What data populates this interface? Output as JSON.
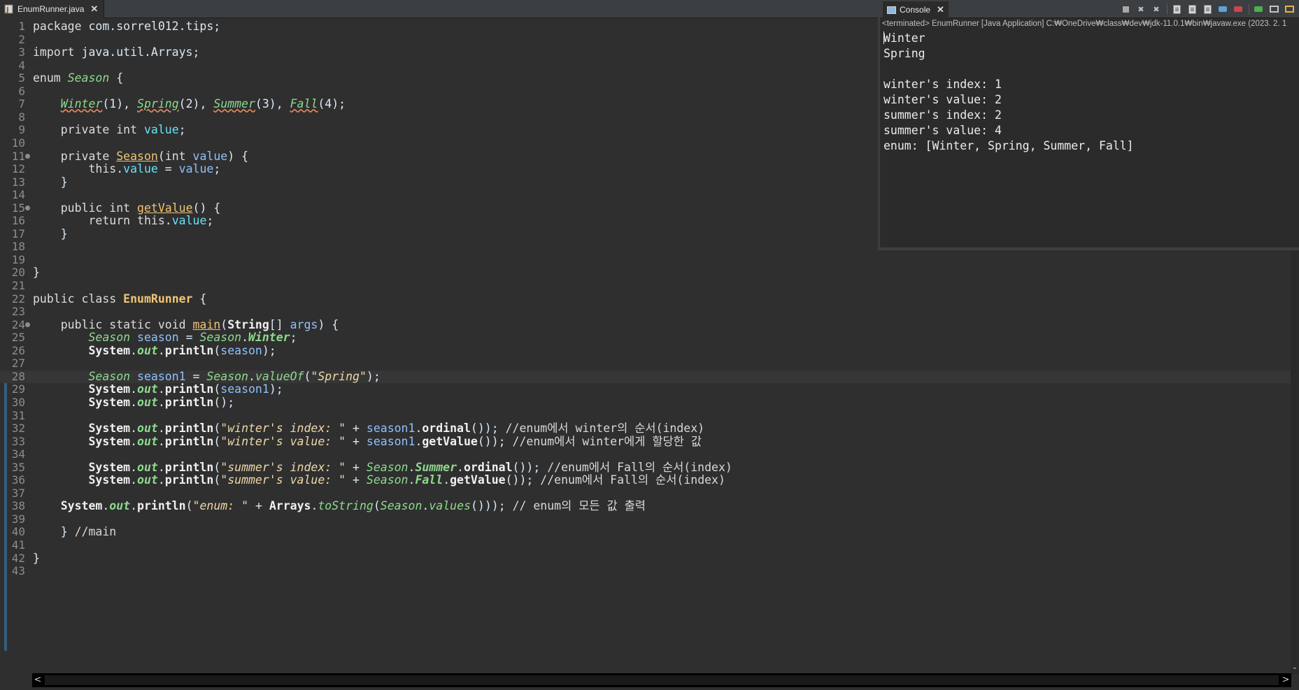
{
  "editor": {
    "tab": {
      "title": "EnumRunner.java",
      "close": "✕"
    },
    "current_line": 28,
    "lines": [
      {
        "n": "1",
        "segs": [
          [
            "kw",
            "package"
          ],
          [
            "t",
            " com.sorrel012.tips;"
          ]
        ]
      },
      {
        "n": "2",
        "segs": []
      },
      {
        "n": "3",
        "segs": [
          [
            "kw",
            "import"
          ],
          [
            "t",
            " java.util.Arrays;"
          ]
        ]
      },
      {
        "n": "4",
        "segs": []
      },
      {
        "n": "5",
        "segs": [
          [
            "kw",
            "enum"
          ],
          [
            "t",
            " "
          ],
          [
            "enm",
            "Season"
          ],
          [
            "t",
            " {"
          ]
        ]
      },
      {
        "n": "6",
        "segs": []
      },
      {
        "n": "7",
        "segs": [
          [
            "t",
            "    "
          ],
          [
            "cstw",
            "Winter"
          ],
          [
            "t",
            "(1), "
          ],
          [
            "cstw",
            "Spring"
          ],
          [
            "t",
            "(2), "
          ],
          [
            "cstw",
            "Summer"
          ],
          [
            "t",
            "(3), "
          ],
          [
            "cstw",
            "Fall"
          ],
          [
            "t",
            "(4);"
          ]
        ]
      },
      {
        "n": "8",
        "segs": []
      },
      {
        "n": "9",
        "segs": [
          [
            "t",
            "    "
          ],
          [
            "kw",
            "private int"
          ],
          [
            "t",
            " "
          ],
          [
            "fld",
            "value"
          ],
          [
            "t",
            ";"
          ]
        ]
      },
      {
        "n": "10",
        "segs": []
      },
      {
        "n": "11",
        "fold": true,
        "segs": [
          [
            "t",
            "    "
          ],
          [
            "kw",
            "private"
          ],
          [
            "t",
            " "
          ],
          [
            "decl",
            "Season"
          ],
          [
            "t",
            "("
          ],
          [
            "kw",
            "int"
          ],
          [
            "t",
            " "
          ],
          [
            "var",
            "value"
          ],
          [
            "t",
            ") {"
          ]
        ]
      },
      {
        "n": "12",
        "segs": [
          [
            "t",
            "        "
          ],
          [
            "kw",
            "this"
          ],
          [
            "t",
            "."
          ],
          [
            "fld",
            "value"
          ],
          [
            "t",
            " = "
          ],
          [
            "var",
            "value"
          ],
          [
            "t",
            ";"
          ]
        ]
      },
      {
        "n": "13",
        "segs": [
          [
            "t",
            "    }"
          ]
        ]
      },
      {
        "n": "14",
        "segs": []
      },
      {
        "n": "15",
        "fold": true,
        "segs": [
          [
            "t",
            "    "
          ],
          [
            "kw",
            "public int"
          ],
          [
            "t",
            " "
          ],
          [
            "decl",
            "getValue"
          ],
          [
            "t",
            "() {"
          ]
        ]
      },
      {
        "n": "16",
        "segs": [
          [
            "t",
            "        "
          ],
          [
            "kw",
            "return this"
          ],
          [
            "t",
            "."
          ],
          [
            "fld",
            "value"
          ],
          [
            "t",
            ";"
          ]
        ]
      },
      {
        "n": "17",
        "segs": [
          [
            "t",
            "    }"
          ]
        ]
      },
      {
        "n": "18",
        "segs": []
      },
      {
        "n": "19",
        "segs": []
      },
      {
        "n": "20",
        "segs": [
          [
            "t",
            "}"
          ]
        ]
      },
      {
        "n": "21",
        "segs": []
      },
      {
        "n": "22",
        "segs": [
          [
            "kw",
            "public class"
          ],
          [
            "t",
            " "
          ],
          [
            "cls",
            "EnumRunner"
          ],
          [
            "t",
            " {"
          ]
        ]
      },
      {
        "n": "23",
        "segs": []
      },
      {
        "n": "24",
        "fold": true,
        "segs": [
          [
            "t",
            "    "
          ],
          [
            "kw",
            "public static void"
          ],
          [
            "t",
            " "
          ],
          [
            "decl",
            "main"
          ],
          [
            "t",
            "("
          ],
          [
            "mth",
            "String"
          ],
          [
            "t",
            "[] "
          ],
          [
            "var",
            "args"
          ],
          [
            "t",
            ") {"
          ]
        ]
      },
      {
        "n": "25",
        "segs": [
          [
            "t",
            "        "
          ],
          [
            "enm",
            "Season"
          ],
          [
            "t",
            " "
          ],
          [
            "var",
            "season"
          ],
          [
            "t",
            " = "
          ],
          [
            "enm",
            "Season"
          ],
          [
            "t",
            "."
          ],
          [
            "sfld",
            "Winter"
          ],
          [
            "t",
            ";"
          ]
        ]
      },
      {
        "n": "26",
        "segs": [
          [
            "t",
            "        "
          ],
          [
            "mth",
            "System"
          ],
          [
            "t",
            "."
          ],
          [
            "sfld",
            "out"
          ],
          [
            "t",
            "."
          ],
          [
            "mth",
            "println"
          ],
          [
            "t",
            "("
          ],
          [
            "var",
            "season"
          ],
          [
            "t",
            ");"
          ]
        ]
      },
      {
        "n": "27",
        "segs": []
      },
      {
        "n": "28",
        "segs": [
          [
            "t",
            "        "
          ],
          [
            "enm",
            "Season"
          ],
          [
            "t",
            " "
          ],
          [
            "var",
            "season1"
          ],
          [
            "t",
            " = "
          ],
          [
            "enm",
            "Season"
          ],
          [
            "t",
            "."
          ],
          [
            "sst",
            "valueOf"
          ],
          [
            "t",
            "("
          ],
          [
            "str",
            "\"Spring\""
          ],
          [
            "t",
            ");"
          ]
        ]
      },
      {
        "n": "29",
        "segs": [
          [
            "t",
            "        "
          ],
          [
            "mth",
            "System"
          ],
          [
            "t",
            "."
          ],
          [
            "sfld",
            "out"
          ],
          [
            "t",
            "."
          ],
          [
            "mth",
            "println"
          ],
          [
            "t",
            "("
          ],
          [
            "var",
            "season1"
          ],
          [
            "t",
            ");"
          ]
        ]
      },
      {
        "n": "30",
        "segs": [
          [
            "t",
            "        "
          ],
          [
            "mth",
            "System"
          ],
          [
            "t",
            "."
          ],
          [
            "sfld",
            "out"
          ],
          [
            "t",
            "."
          ],
          [
            "mth",
            "println"
          ],
          [
            "t",
            "();"
          ]
        ]
      },
      {
        "n": "31",
        "segs": []
      },
      {
        "n": "32",
        "segs": [
          [
            "t",
            "        "
          ],
          [
            "mth",
            "System"
          ],
          [
            "t",
            "."
          ],
          [
            "sfld",
            "out"
          ],
          [
            "t",
            "."
          ],
          [
            "mth",
            "println"
          ],
          [
            "t",
            "("
          ],
          [
            "str",
            "\"winter's index: \""
          ],
          [
            "t",
            " + "
          ],
          [
            "var",
            "season1"
          ],
          [
            "t",
            "."
          ],
          [
            "mth",
            "ordinal"
          ],
          [
            "t",
            "()); "
          ],
          [
            "cmt",
            "//enum에서 winter의 순서(index)"
          ]
        ]
      },
      {
        "n": "33",
        "segs": [
          [
            "t",
            "        "
          ],
          [
            "mth",
            "System"
          ],
          [
            "t",
            "."
          ],
          [
            "sfld",
            "out"
          ],
          [
            "t",
            "."
          ],
          [
            "mth",
            "println"
          ],
          [
            "t",
            "("
          ],
          [
            "str",
            "\"winter's value: \""
          ],
          [
            "t",
            " + "
          ],
          [
            "var",
            "season1"
          ],
          [
            "t",
            "."
          ],
          [
            "mth",
            "getValue"
          ],
          [
            "t",
            "()); "
          ],
          [
            "cmt",
            "//enum에서 winter에게 할당한 값"
          ]
        ]
      },
      {
        "n": "34",
        "segs": []
      },
      {
        "n": "35",
        "segs": [
          [
            "t",
            "        "
          ],
          [
            "mth",
            "System"
          ],
          [
            "t",
            "."
          ],
          [
            "sfld",
            "out"
          ],
          [
            "t",
            "."
          ],
          [
            "mth",
            "println"
          ],
          [
            "t",
            "("
          ],
          [
            "str",
            "\"summer's index: \""
          ],
          [
            "t",
            " + "
          ],
          [
            "enm",
            "Season"
          ],
          [
            "t",
            "."
          ],
          [
            "sfld",
            "Summer"
          ],
          [
            "t",
            "."
          ],
          [
            "mth",
            "ordinal"
          ],
          [
            "t",
            "()); "
          ],
          [
            "cmt",
            "//enum에서 Fall의 순서(index)"
          ]
        ]
      },
      {
        "n": "36",
        "segs": [
          [
            "t",
            "        "
          ],
          [
            "mth",
            "System"
          ],
          [
            "t",
            "."
          ],
          [
            "sfld",
            "out"
          ],
          [
            "t",
            "."
          ],
          [
            "mth",
            "println"
          ],
          [
            "t",
            "("
          ],
          [
            "str",
            "\"summer's value: \""
          ],
          [
            "t",
            " + "
          ],
          [
            "enm",
            "Season"
          ],
          [
            "t",
            "."
          ],
          [
            "sfld",
            "Fall"
          ],
          [
            "t",
            "."
          ],
          [
            "mth",
            "getValue"
          ],
          [
            "t",
            "()); "
          ],
          [
            "cmt",
            "//enum에서 Fall의 순서(index)"
          ]
        ]
      },
      {
        "n": "37",
        "segs": []
      },
      {
        "n": "38",
        "segs": [
          [
            "t",
            "    "
          ],
          [
            "mth",
            "System"
          ],
          [
            "t",
            "."
          ],
          [
            "sfld",
            "out"
          ],
          [
            "t",
            "."
          ],
          [
            "mth",
            "println"
          ],
          [
            "t",
            "("
          ],
          [
            "str",
            "\"enum: \""
          ],
          [
            "t",
            " + "
          ],
          [
            "mth",
            "Arrays"
          ],
          [
            "t",
            "."
          ],
          [
            "sst",
            "toString"
          ],
          [
            "t",
            "("
          ],
          [
            "enm",
            "Season"
          ],
          [
            "t",
            "."
          ],
          [
            "sst",
            "values"
          ],
          [
            "t",
            "())); "
          ],
          [
            "cmt",
            "// enum의 모든 값 출력"
          ]
        ]
      },
      {
        "n": "39",
        "segs": []
      },
      {
        "n": "40",
        "segs": [
          [
            "t",
            "    } "
          ],
          [
            "cmt",
            "//main"
          ]
        ]
      },
      {
        "n": "41",
        "segs": []
      },
      {
        "n": "42",
        "segs": [
          [
            "t",
            "}"
          ]
        ]
      },
      {
        "n": "43",
        "segs": []
      }
    ]
  },
  "console": {
    "tab": {
      "title": "Console",
      "close": "✕"
    },
    "status": "<terminated> EnumRunner [Java Application] C:₩OneDrive₩class₩dev₩jdk-11.0.1₩bin₩javaw.exe  (2023. 2. 1",
    "output": [
      "Winter",
      "Spring",
      "",
      "winter's index: 1",
      "winter's value: 2",
      "summer's index: 2",
      "summer's value: 4",
      "enum: [Winter, Spring, Summer, Fall]"
    ]
  },
  "scrollbar": {
    "left_arrow": "<",
    "right_arrow": ">",
    "down_arrow": "⌄"
  },
  "colors": {
    "editor_bg": "#2f2f2f",
    "keyword": "#dddddd",
    "field": "#66e1f8",
    "static_italic": "#8dda8d",
    "string": "#f0d8a8",
    "declaration": "#f0c674",
    "line_number": "#8d8d8d"
  }
}
